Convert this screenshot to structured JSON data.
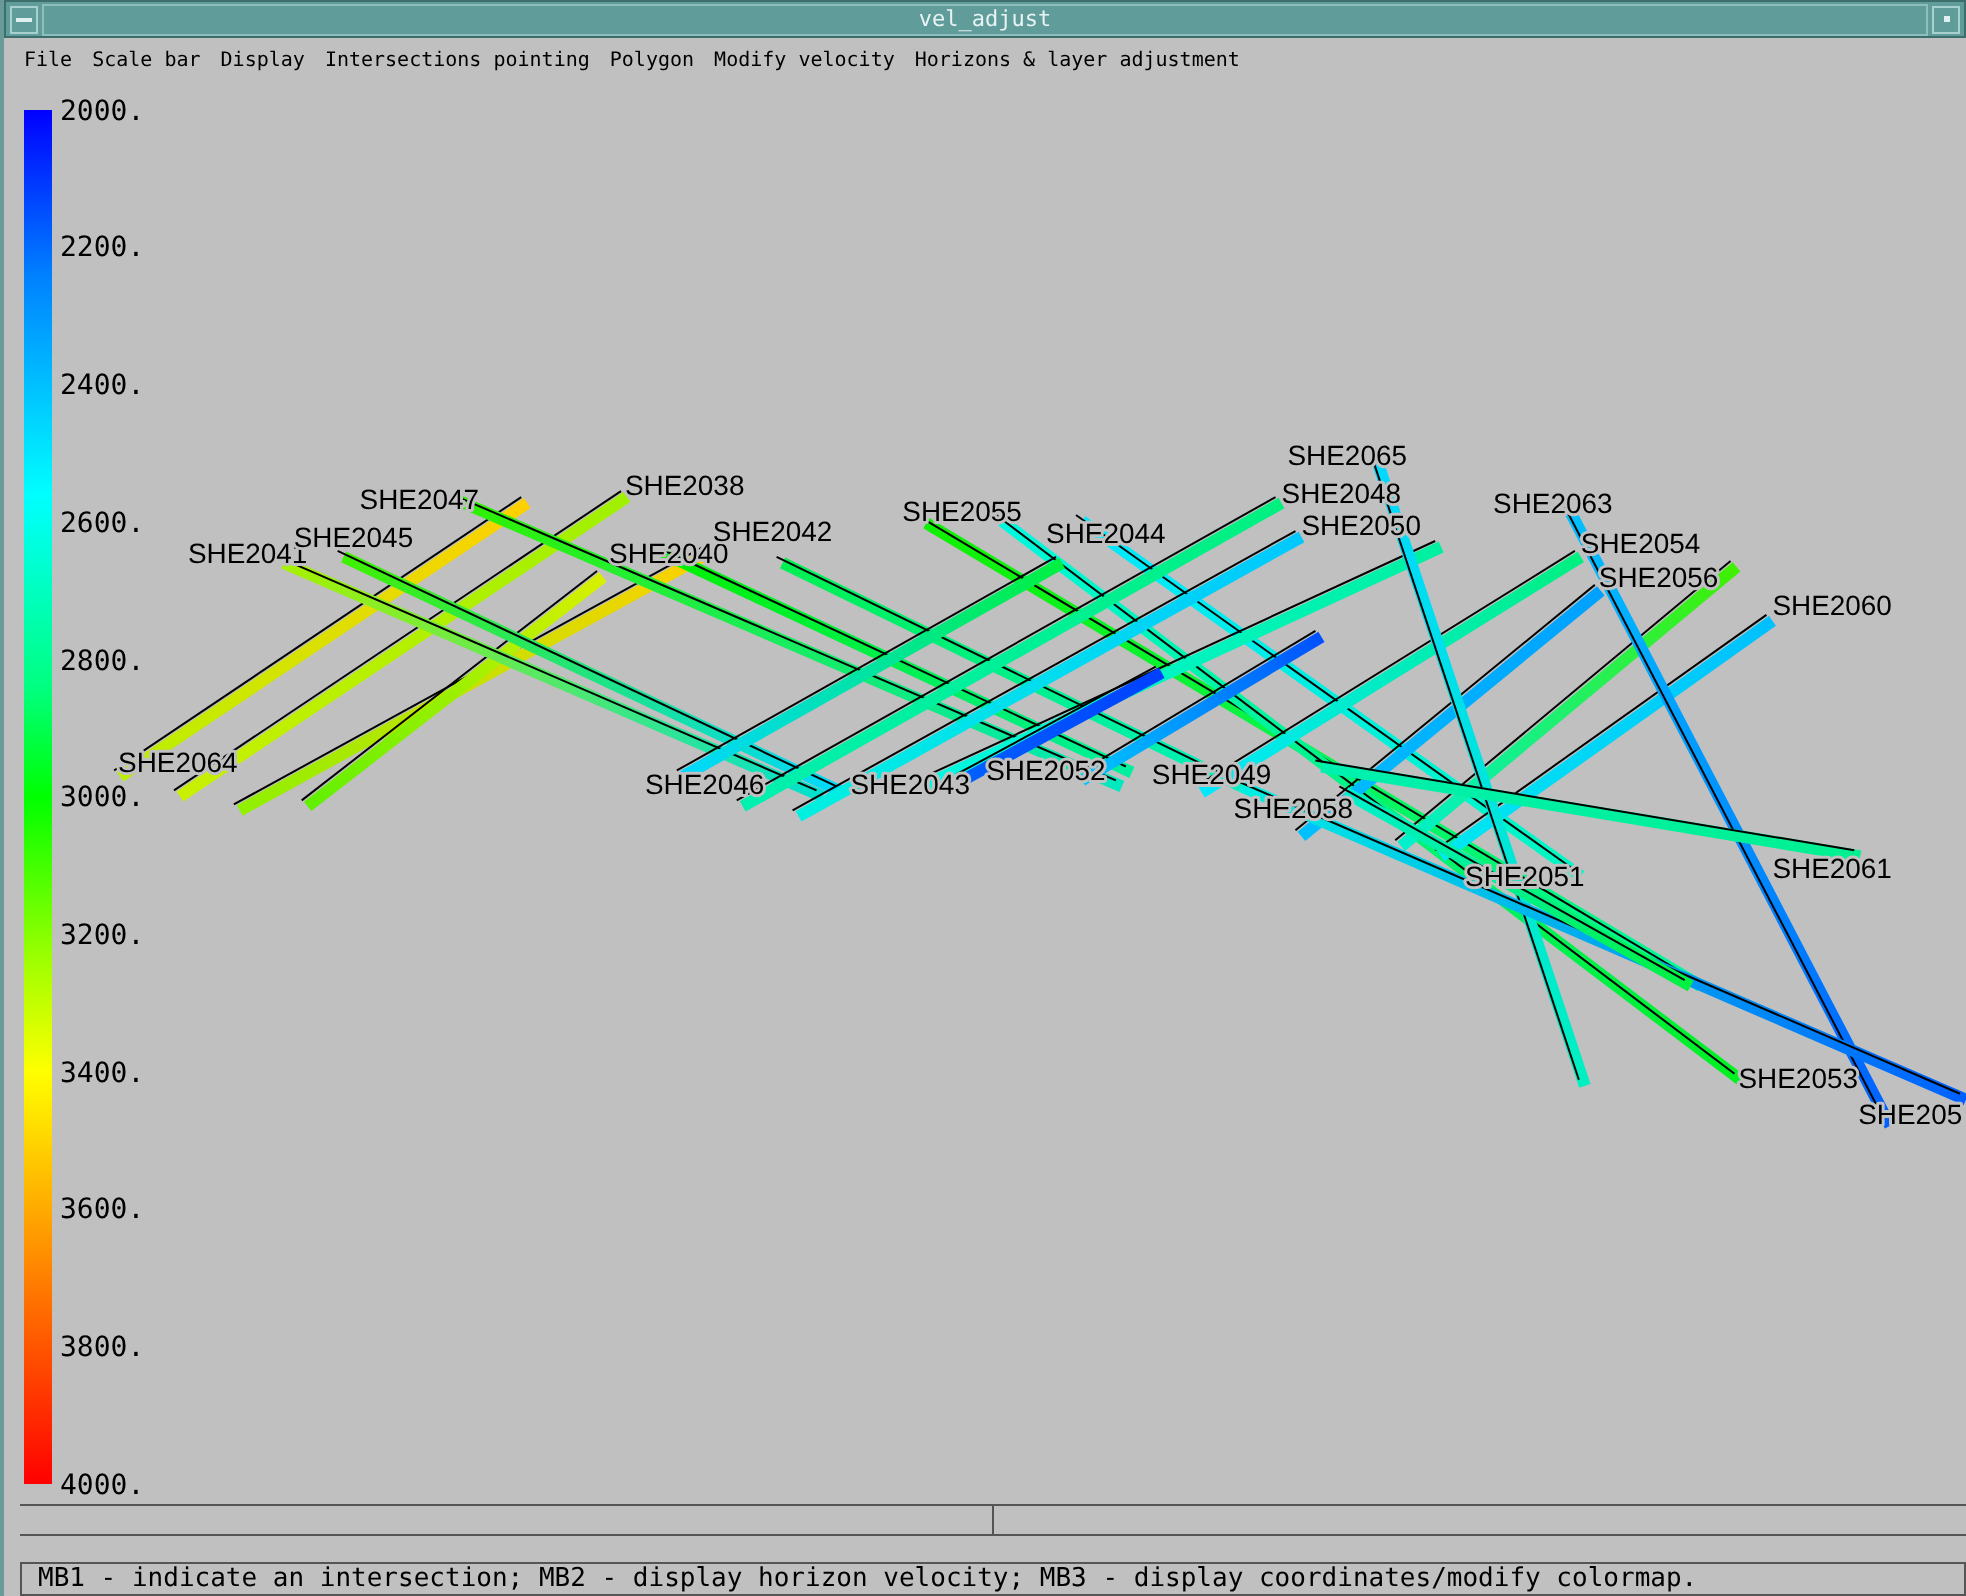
{
  "window": {
    "title": "vel_adjust"
  },
  "menu": [
    {
      "label": "File"
    },
    {
      "label": "Scale bar"
    },
    {
      "label": "Display"
    },
    {
      "label": "Intersections pointing"
    },
    {
      "label": "Polygon"
    },
    {
      "label": "Modify velocity"
    },
    {
      "label": "Horizons & layer adjustment"
    }
  ],
  "color_scale": {
    "ticks": [
      "2000.",
      "2200.",
      "2400.",
      "2600.",
      "2800.",
      "3000.",
      "3200.",
      "3400.",
      "3600.",
      "3800.",
      "4000."
    ]
  },
  "map": {
    "line_labels": [
      "SHE2047",
      "SHE2038",
      "SHE2041",
      "SHE2045",
      "SHE2040",
      "SHE2042",
      "SHE2055",
      "SHE2044",
      "SHE2065",
      "SHE2048",
      "SHE2050",
      "SHE2063",
      "SHE2054",
      "SHE2056",
      "SHE2060",
      "SHE2064",
      "SHE2046",
      "SHE2043",
      "SHE2052",
      "SHE2049",
      "SHE2058",
      "SHE2051",
      "SHE2061",
      "SHE2053",
      "SHE205"
    ]
  },
  "status_bar": {
    "text": "MB1 - indicate an intersection; MB2 - display horizon velocity; MB3 - display coordinates/modify colormap."
  }
}
